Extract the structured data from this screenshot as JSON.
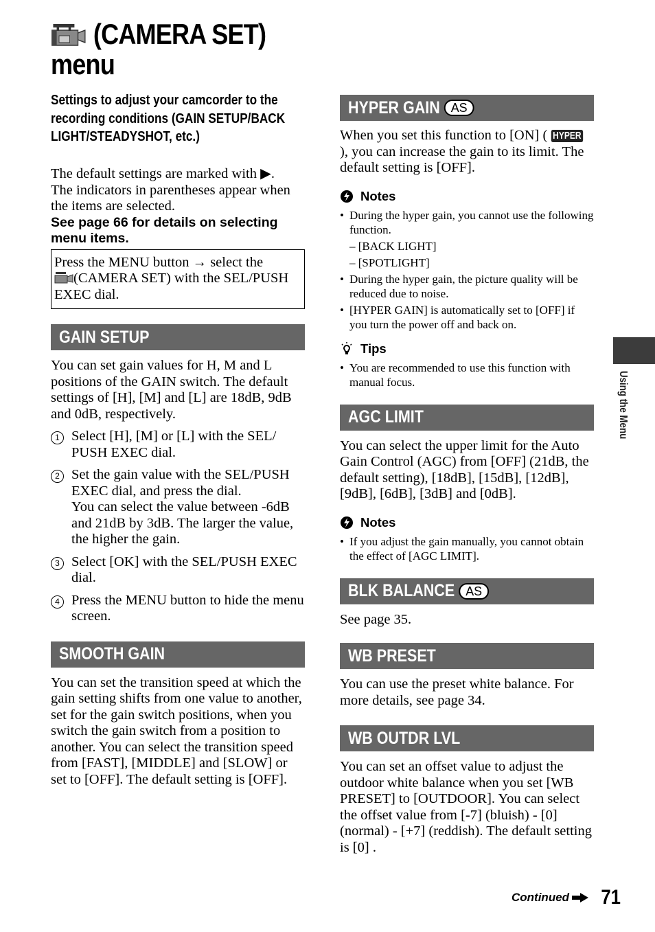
{
  "page": {
    "title_line1": "(CAMERA SET)",
    "title_line2": "menu",
    "title_icon": "camera-set-icon",
    "subtitle": "Settings to adjust your camcorder to the recording conditions (GAIN SETUP/BACK LIGHT/STEADYSHOT, etc.)",
    "intro_line1": "The default settings are marked with ▶.",
    "intro_line2": "The indicators in parentheses appear when the items are selected.",
    "see_page": "See page 66 for details on selecting menu items.",
    "instruction_box": {
      "part1": "Press the MENU button",
      "arrow": "→",
      "part2": "select the",
      "part3": "(CAMERA SET) with the SEL/PUSH EXEC dial."
    },
    "side_tab_label": "Using the Menu",
    "footer": {
      "continued": "Continued",
      "page_number": "71"
    }
  },
  "sections": {
    "gain_setup": {
      "title": "GAIN SETUP",
      "body": "You can set gain values for H, M and L positions of the GAIN switch. The default settings of [H], [M] and [L] are 18dB, 9dB and 0dB, respectively.",
      "steps": [
        {
          "num": "1",
          "text": "Select [H], [M] or [L] with the SEL/ PUSH EXEC dial."
        },
        {
          "num": "2",
          "text": "Set the gain value with the SEL/PUSH EXEC dial, and press the dial.",
          "extra": "You can select the value between -6dB and 21dB by 3dB. The larger the value, the higher the gain."
        },
        {
          "num": "3",
          "text": "Select [OK] with the SEL/PUSH EXEC dial."
        },
        {
          "num": "4",
          "text": "Press the MENU button to hide the menu screen."
        }
      ]
    },
    "smooth_gain": {
      "title": "SMOOTH GAIN",
      "body": "You can set the transition speed at which the gain setting shifts from one value to another, set for the gain switch positions, when you switch the gain switch from a position to another. You can select the transition speed from [FAST], [MIDDLE] and [SLOW] or set to [OFF]. The default setting is [OFF]."
    },
    "hyper_gain": {
      "title": "HYPER GAIN",
      "badge": "AS",
      "body_part1": "When you set this function to [ON] (",
      "indicator": "HYPER",
      "body_part2": "), you can increase the gain to its limit. The default setting is [OFF].",
      "notes_label": "Notes",
      "notes": [
        {
          "text": "During the hyper gain, you cannot use the following function.",
          "sub": [
            "– [BACK LIGHT]",
            "– [SPOTLIGHT]"
          ]
        },
        {
          "text": "During the hyper gain, the picture quality will be reduced due to noise."
        },
        {
          "text": "[HYPER GAIN] is automatically set to [OFF] if you turn the power off and back on."
        }
      ],
      "tips_label": "Tips",
      "tips": [
        "You are recommended to use this function with manual focus."
      ]
    },
    "agc_limit": {
      "title": "AGC LIMIT",
      "body": "You can select the upper limit for the Auto Gain Control (AGC) from [OFF] (21dB, the default setting), [18dB], [15dB], [12dB], [9dB], [6dB], [3dB] and [0dB].",
      "notes_label": "Notes",
      "notes": [
        "If you adjust the gain manually, you cannot obtain the effect of [AGC LIMIT]."
      ]
    },
    "blk_balance": {
      "title": "BLK BALANCE",
      "badge": "AS",
      "body": "See page 35."
    },
    "wb_preset": {
      "title": "WB PRESET",
      "body": "You can use the preset white balance. For more details, see page 34."
    },
    "wb_outdr_lvl": {
      "title": "WB OUTDR LVL",
      "body": "You can set an offset value to adjust the outdoor white balance when you set [WB PRESET] to [OUTDOOR]. You can select the offset value from [-7] (bluish) - [0] (normal) - [+7] (reddish). The default setting is [0] ."
    }
  },
  "colors": {
    "header_bar": "#666666",
    "side_tab": "#3c3c3c",
    "text": "#000000"
  }
}
